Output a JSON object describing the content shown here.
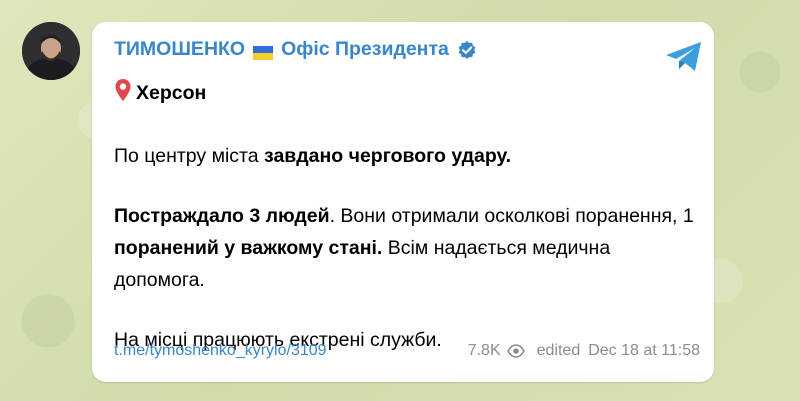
{
  "channel": {
    "name": "ТИМОШЕНКО",
    "name_suffix": "Офіс Президента",
    "accent_color": "#3a86c8",
    "verified_icon": "verified-badge-icon",
    "flag_icon": "ukraine-flag-icon"
  },
  "message": {
    "location": "Херсон",
    "paragraph1": {
      "plain": "По центру міста ",
      "bold": "завдано чергового удару."
    },
    "paragraph2": {
      "bold1": "Постраждало 3 людей",
      "plain1": ". Вони отримали осколкові поранення, 1 ",
      "bold2": "поранений у важкому стані.",
      "plain2": " Всім надається медична допомога."
    },
    "paragraph3": "На місці працюють екстрені служби."
  },
  "footer": {
    "link": "t.me/tymoshenko_kyrylo/3109",
    "views": "7.8K",
    "edited_label": "edited",
    "date": "Dec 18 at 11:58"
  },
  "icons": {
    "share": "telegram-share-icon",
    "eye": "eye-icon",
    "pin": "location-pin-icon"
  }
}
